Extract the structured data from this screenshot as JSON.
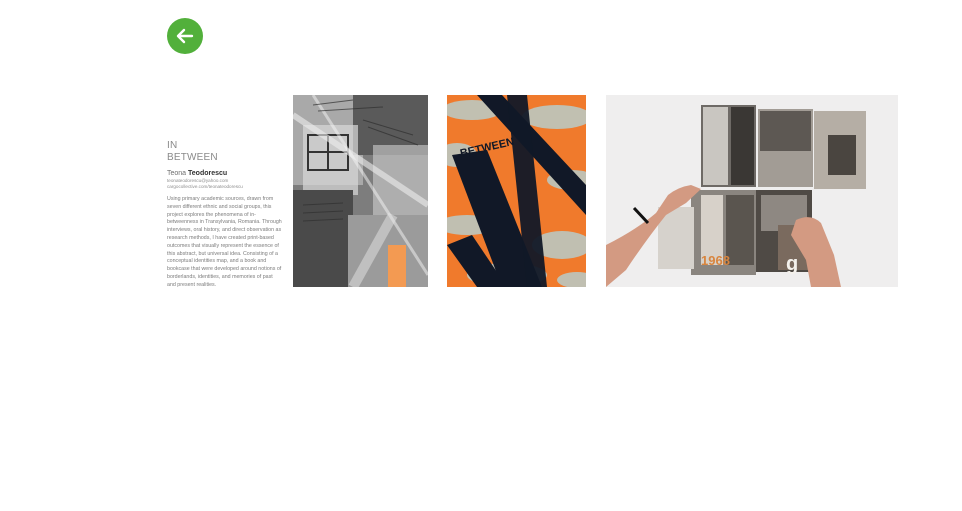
{
  "nav": {
    "back_icon": "arrow-left-icon",
    "accent_color": "#52b03b"
  },
  "project": {
    "title_line1": "IN",
    "title_line2": "BETWEEN",
    "author_first": "Teona",
    "author_last": "Teodorescu",
    "email": "teonateodorescu@yahoo.com",
    "website": "cargocollective.com/teonateodorescu",
    "description": "Using primary academic sources, drawn from seven different ethnic and social groups, this project explores the phenomena of in-betweenness in Transylvania, Romania. Through interviews, oral history, and direct observation as research methods, I have created print-based outcomes that visually represent the essence of this abstract, but universal idea. Consisting of a conceptual identities map, and a book and bookcase that were developed around notions of borderlands, identities, and memories of past and present realities."
  },
  "gallery": {
    "image2_text": "BETWEEN",
    "image3_number": "1968"
  }
}
